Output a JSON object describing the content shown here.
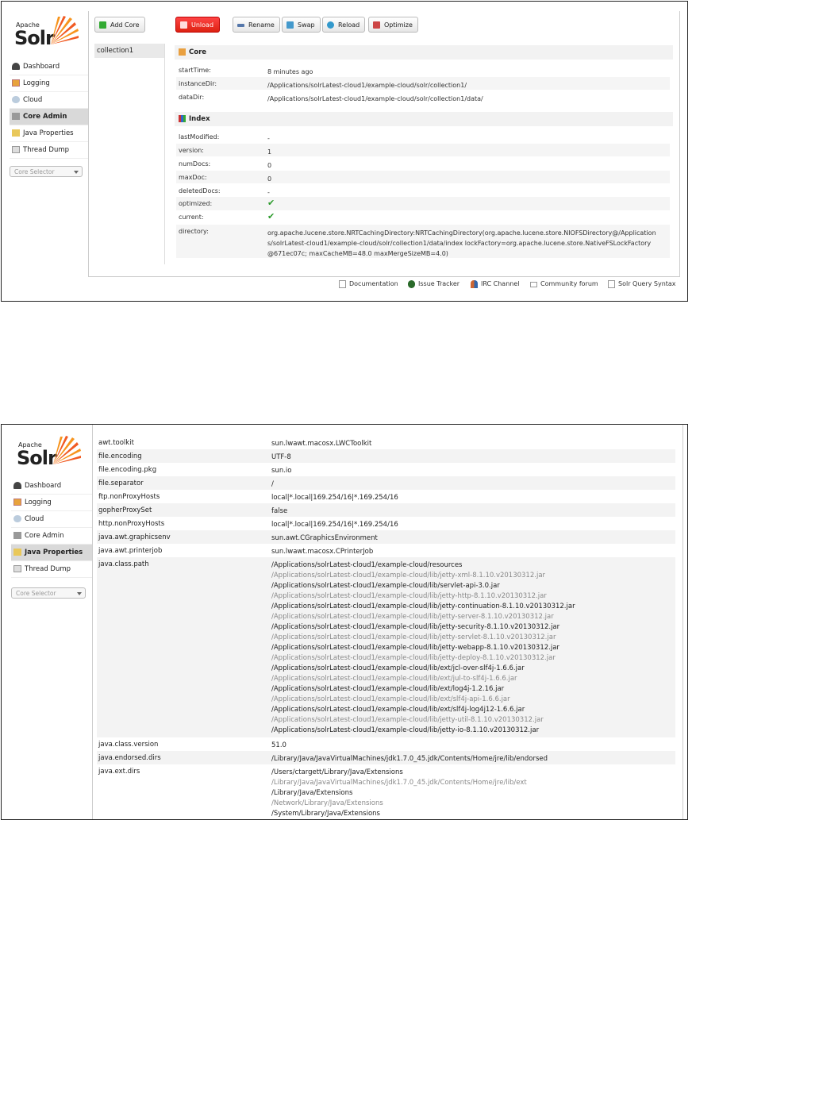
{
  "logo": {
    "apache": "Apache",
    "solr": "Solr"
  },
  "nav": {
    "dashboard": "Dashboard",
    "logging": "Logging",
    "cloud": "Cloud",
    "core_admin": "Core Admin",
    "java_properties": "Java Properties",
    "thread_dump": "Thread Dump"
  },
  "core_selector": {
    "label": "Core Selector"
  },
  "screen1": {
    "toolbar": {
      "add_core": "Add Core",
      "unload": "Unload",
      "rename": "Rename",
      "swap": "Swap",
      "reload": "Reload",
      "optimize": "Optimize"
    },
    "cores": [
      "collection1"
    ],
    "core_section": {
      "title": "Core",
      "rows": [
        {
          "key": "startTime:",
          "value": "8 minutes ago"
        },
        {
          "key": "instanceDir:",
          "value": "/Applications/solrLatest-cloud1/example-cloud/solr/collection1/"
        },
        {
          "key": "dataDir:",
          "value": "/Applications/solrLatest-cloud1/example-cloud/solr/collection1/data/"
        }
      ]
    },
    "index_section": {
      "title": "Index",
      "rows": [
        {
          "key": "lastModified:",
          "value": "-"
        },
        {
          "key": "version:",
          "value": "1"
        },
        {
          "key": "numDocs:",
          "value": "0"
        },
        {
          "key": "maxDoc:",
          "value": "0"
        },
        {
          "key": "deletedDocs:",
          "value": "-"
        },
        {
          "key": "optimized:",
          "value": "✔"
        },
        {
          "key": "current:",
          "value": "✔"
        },
        {
          "key": "directory:",
          "value": "org.apache.lucene.store.NRTCachingDirectory:NRTCachingDirectory(org.apache.lucene.store.NIOFSDirectory@/Applications/solrLatest-cloud1/example-cloud/solr/collection1/data/index lockFactory=org.apache.lucene.store.NativeFSLockFactory@671ec07c; maxCacheMB=48.0 maxMergeSizeMB=4.0)"
        }
      ]
    },
    "footer": {
      "documentation": "Documentation",
      "issue_tracker": "Issue Tracker",
      "irc_channel": "IRC Channel",
      "community_forum": "Community forum",
      "query_syntax": "Solr Query Syntax"
    }
  },
  "screen2": {
    "properties": [
      {
        "key": "awt.toolkit",
        "values": [
          "sun.lwawt.macosx.LWCToolkit"
        ]
      },
      {
        "key": "file.encoding",
        "values": [
          "UTF-8"
        ]
      },
      {
        "key": "file.encoding.pkg",
        "values": [
          "sun.io"
        ]
      },
      {
        "key": "file.separator",
        "values": [
          "/"
        ]
      },
      {
        "key": "ftp.nonProxyHosts",
        "values": [
          "local|*.local|169.254/16|*.169.254/16"
        ]
      },
      {
        "key": "gopherProxySet",
        "values": [
          "false"
        ]
      },
      {
        "key": "http.nonProxyHosts",
        "values": [
          "local|*.local|169.254/16|*.169.254/16"
        ]
      },
      {
        "key": "java.awt.graphicsenv",
        "values": [
          "sun.awt.CGraphicsEnvironment"
        ]
      },
      {
        "key": "java.awt.printerjob",
        "values": [
          "sun.lwawt.macosx.CPrinterJob"
        ]
      },
      {
        "key": "java.class.path",
        "values": [
          "/Applications/solrLatest-cloud1/example-cloud/resources",
          "/Applications/solrLatest-cloud1/example-cloud/lib/jetty-xml-8.1.10.v20130312.jar",
          "/Applications/solrLatest-cloud1/example-cloud/lib/servlet-api-3.0.jar",
          "/Applications/solrLatest-cloud1/example-cloud/lib/jetty-http-8.1.10.v20130312.jar",
          "/Applications/solrLatest-cloud1/example-cloud/lib/jetty-continuation-8.1.10.v20130312.jar",
          "/Applications/solrLatest-cloud1/example-cloud/lib/jetty-server-8.1.10.v20130312.jar",
          "/Applications/solrLatest-cloud1/example-cloud/lib/jetty-security-8.1.10.v20130312.jar",
          "/Applications/solrLatest-cloud1/example-cloud/lib/jetty-servlet-8.1.10.v20130312.jar",
          "/Applications/solrLatest-cloud1/example-cloud/lib/jetty-webapp-8.1.10.v20130312.jar",
          "/Applications/solrLatest-cloud1/example-cloud/lib/jetty-deploy-8.1.10.v20130312.jar",
          "/Applications/solrLatest-cloud1/example-cloud/lib/ext/jcl-over-slf4j-1.6.6.jar",
          "/Applications/solrLatest-cloud1/example-cloud/lib/ext/jul-to-slf4j-1.6.6.jar",
          "/Applications/solrLatest-cloud1/example-cloud/lib/ext/log4j-1.2.16.jar",
          "/Applications/solrLatest-cloud1/example-cloud/lib/ext/slf4j-api-1.6.6.jar",
          "/Applications/solrLatest-cloud1/example-cloud/lib/ext/slf4j-log4j12-1.6.6.jar",
          "/Applications/solrLatest-cloud1/example-cloud/lib/jetty-util-8.1.10.v20130312.jar",
          "/Applications/solrLatest-cloud1/example-cloud/lib/jetty-io-8.1.10.v20130312.jar"
        ]
      },
      {
        "key": "java.class.version",
        "values": [
          "51.0"
        ]
      },
      {
        "key": "java.endorsed.dirs",
        "values": [
          "/Library/Java/JavaVirtualMachines/jdk1.7.0_45.jdk/Contents/Home/jre/lib/endorsed"
        ]
      },
      {
        "key": "java.ext.dirs",
        "values": [
          "/Users/ctargett/Library/Java/Extensions",
          "/Library/Java/JavaVirtualMachines/jdk1.7.0_45.jdk/Contents/Home/jre/lib/ext",
          "/Library/Java/Extensions",
          "/Network/Library/Java/Extensions",
          "/System/Library/Java/Extensions"
        ]
      }
    ]
  }
}
